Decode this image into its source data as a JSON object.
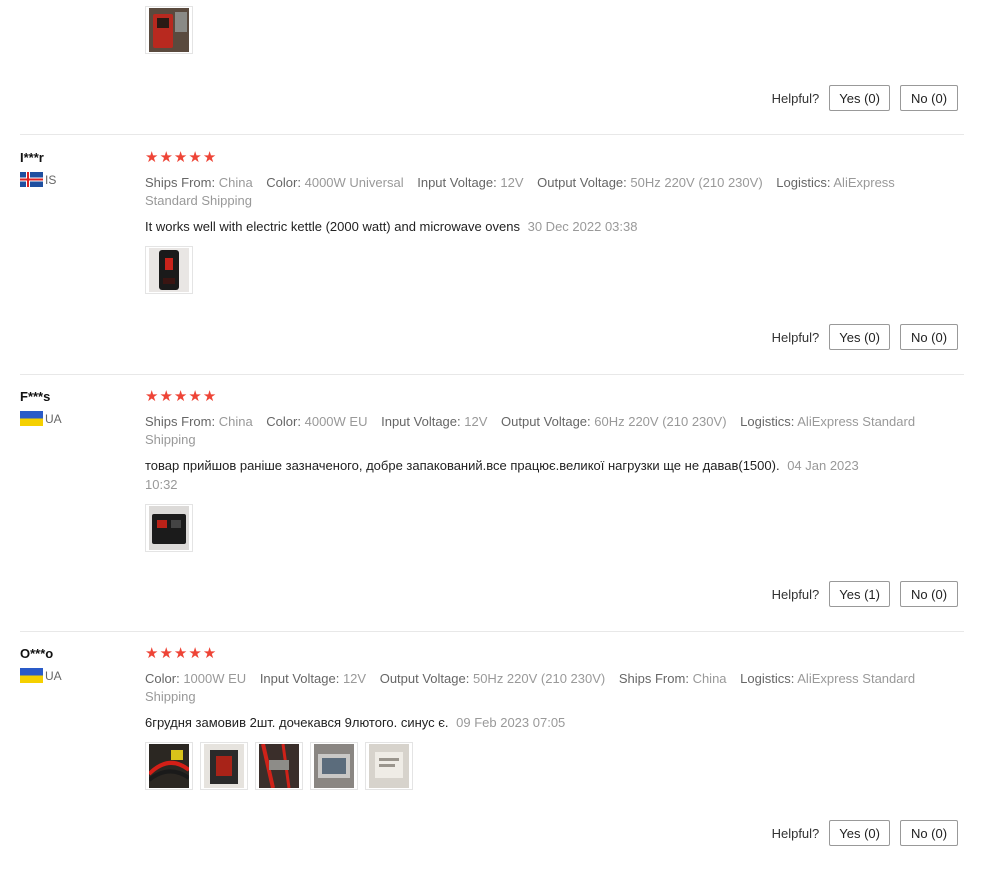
{
  "helpful_label": "Helpful?",
  "star_color": "#ee4436",
  "top_block": {
    "photos": [
      "photo-red-device"
    ],
    "yes": "Yes (0)",
    "no": "No (0)"
  },
  "reviews": [
    {
      "user": "I***r",
      "country": "IS",
      "flag": "iceland-flag",
      "stars": 5,
      "attrs": [
        {
          "label": "Ships From:",
          "value": "China"
        },
        {
          "label": "Color:",
          "value": "4000W Universal"
        },
        {
          "label": "Input Voltage:",
          "value": "12V"
        },
        {
          "label": "Output Voltage:",
          "value": "50Hz 220V (210 230V)"
        },
        {
          "label": "Logistics:",
          "value": "AliExpress Standard Shipping"
        }
      ],
      "text": "It works well with electric kettle (2000 watt) and microwave ovens",
      "date": "30 Dec 2022 03:38",
      "photos": [
        "photo-kettle"
      ],
      "yes": "Yes (0)",
      "no": "No (0)"
    },
    {
      "user": "F***s",
      "country": "UA",
      "flag": "ukraine-flag",
      "stars": 5,
      "attrs": [
        {
          "label": "Ships From:",
          "value": "China"
        },
        {
          "label": "Color:",
          "value": "4000W EU"
        },
        {
          "label": "Input Voltage:",
          "value": "12V"
        },
        {
          "label": "Output Voltage:",
          "value": "60Hz 220V (210 230V)"
        },
        {
          "label": "Logistics:",
          "value": "AliExpress Standard Shipping"
        }
      ],
      "text": "товар прийшов раніше зазначеного, добре запакований.все працює.великої нагрузки ще не давав(1500).",
      "date": "04 Jan 2023 10:32",
      "photos": [
        "photo-inverter-dark"
      ],
      "yes": "Yes (1)",
      "no": "No (0)"
    },
    {
      "user": "O***o",
      "country": "UA",
      "flag": "ukraine-flag",
      "stars": 5,
      "attrs": [
        {
          "label": "Color:",
          "value": "1000W EU"
        },
        {
          "label": "Input Voltage:",
          "value": "12V"
        },
        {
          "label": "Output Voltage:",
          "value": "50Hz 220V (210 230V)"
        },
        {
          "label": "Ships From:",
          "value": "China"
        },
        {
          "label": "Logistics:",
          "value": "AliExpress Standard Shipping"
        }
      ],
      "text": "6грудня замовив 2шт. дочекався 9лютого. синус є.",
      "date": "09 Feb 2023 07:05",
      "photos": [
        "photo-wiring-1",
        "photo-inverter-red",
        "photo-wiring-2",
        "photo-inverter-box",
        "photo-label"
      ],
      "yes": "Yes (0)",
      "no": "No (0)"
    }
  ]
}
